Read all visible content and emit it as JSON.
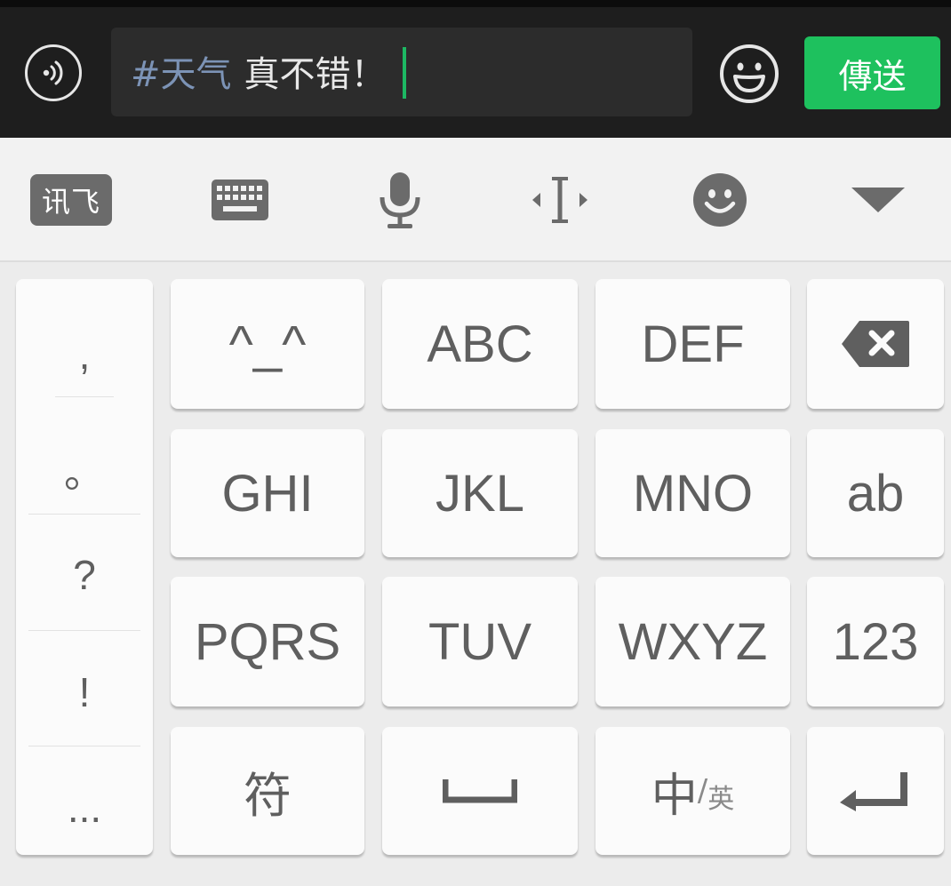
{
  "chat_bar": {
    "input_tag": "#天气",
    "input_text": "真不错！",
    "send_label": "傳送",
    "voice_icon": "voice-wave-icon",
    "emoji_icon": "smiley-face-icon",
    "send_color": "#1ec15e"
  },
  "ime_toolbar": {
    "brand_label": "讯飞",
    "items": [
      "keyboard-icon",
      "microphone-icon",
      "cursor-move-icon",
      "emoji-face-icon",
      "collapse-triangle-icon"
    ]
  },
  "punctuation": [
    ",",
    "。",
    "?",
    "!",
    "..."
  ],
  "keys": {
    "kaomoji": "^_^",
    "abc": "ABC",
    "def": "DEF",
    "ghi": "GHI",
    "jkl": "JKL",
    "mno": "MNO",
    "ab": "ab",
    "pqrs": "PQRS",
    "tuv": "TUV",
    "wxyz": "WXYZ",
    "num": "123",
    "symbol": "符",
    "lang_main": "中",
    "lang_sep": "/",
    "lang_sub": "英",
    "backspace_icon": "backspace-icon",
    "space_icon": "space-bar-icon",
    "enter_icon": "enter-return-icon"
  }
}
